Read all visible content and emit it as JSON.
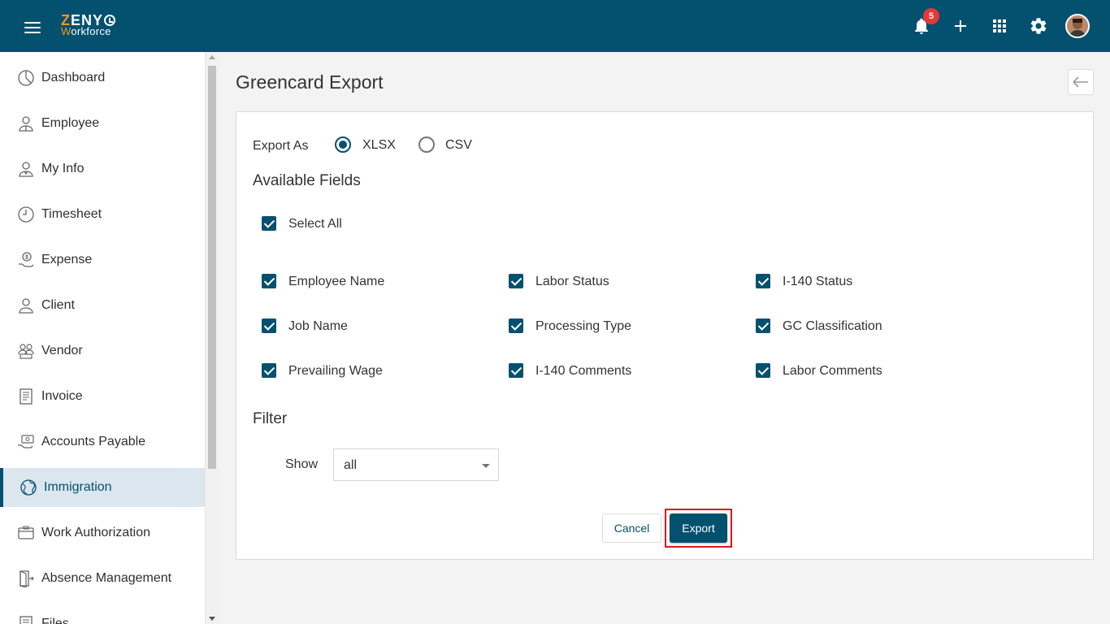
{
  "colors": {
    "brand": "#04506f",
    "accent_orange": "#f7941d",
    "highlight": "#e0151b"
  },
  "header": {
    "logo_top": "ZENY",
    "logo_bottom_first": "W",
    "logo_bottom_rest": "orkforce",
    "notification_count": "5",
    "icons": [
      "menu-icon",
      "bell-icon",
      "plus-icon",
      "apps-grid-icon",
      "gear-icon",
      "avatar"
    ]
  },
  "sidebar": {
    "items": [
      {
        "label": "Dashboard",
        "icon": "dashboard-icon"
      },
      {
        "label": "Employee",
        "icon": "employee-icon"
      },
      {
        "label": "My Info",
        "icon": "my-info-icon"
      },
      {
        "label": "Timesheet",
        "icon": "clock-icon"
      },
      {
        "label": "Expense",
        "icon": "expense-icon"
      },
      {
        "label": "Client",
        "icon": "client-icon"
      },
      {
        "label": "Vendor",
        "icon": "vendor-icon"
      },
      {
        "label": "Invoice",
        "icon": "invoice-icon"
      },
      {
        "label": "Accounts Payable",
        "icon": "accounts-payable-icon"
      },
      {
        "label": "Immigration",
        "icon": "globe-icon",
        "active": true
      },
      {
        "label": "Work Authorization",
        "icon": "id-card-icon"
      },
      {
        "label": "Absence Management",
        "icon": "door-icon"
      },
      {
        "label": "Files",
        "icon": "file-icon"
      }
    ]
  },
  "main": {
    "title": "Greencard Export",
    "export_as_label": "Export As",
    "format_options": [
      {
        "label": "XLSX",
        "checked": true
      },
      {
        "label": "CSV",
        "checked": false
      }
    ],
    "available_fields_title": "Available Fields",
    "select_all_label": "Select All",
    "fields": [
      [
        "Employee Name",
        "Labor Status",
        "I-140 Status"
      ],
      [
        "Job Name",
        "Processing Type",
        "GC Classification"
      ],
      [
        "Prevailing Wage",
        "I-140 Comments",
        "Labor Comments"
      ]
    ],
    "filter_title": "Filter",
    "show_label": "Show",
    "show_value": "all",
    "cancel_label": "Cancel",
    "export_label": "Export"
  }
}
